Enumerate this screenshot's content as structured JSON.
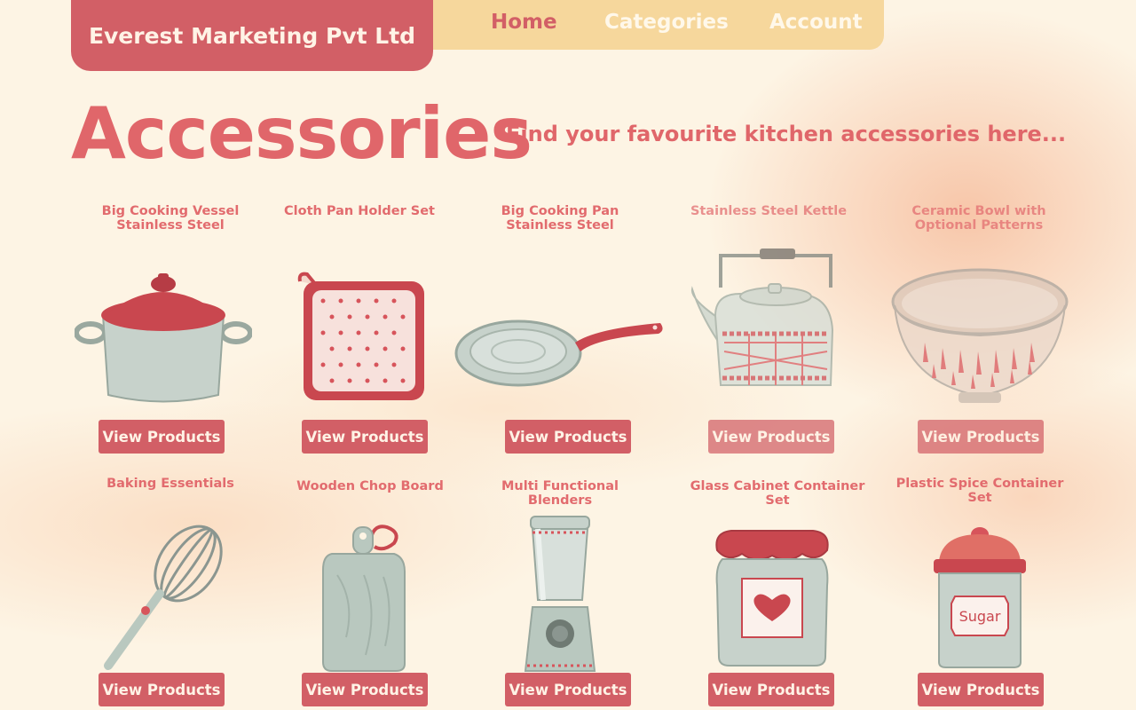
{
  "brand": "Everest Marketing Pvt Ltd",
  "nav": {
    "items": [
      {
        "label": "Home",
        "active": true
      },
      {
        "label": "Categories",
        "active": false
      },
      {
        "label": "Account",
        "active": false
      }
    ]
  },
  "page": {
    "title": "Accessories",
    "subtitle": "Find your favourite kitchen accessories here..."
  },
  "colors": {
    "accent": "#d25f66",
    "nav_bg": "#f6d79c",
    "page_bg": "#fdf4e4",
    "title": "#e0666a"
  },
  "products": [
    {
      "title": "Big Cooking Vessel Stainless Steel",
      "button": "View Products",
      "icon": "cooking-pot-icon"
    },
    {
      "title": "Cloth Pan Holder Set",
      "button": "View Products",
      "icon": "pan-holder-icon"
    },
    {
      "title": "Big Cooking Pan Stainless Steel",
      "button": "View Products",
      "icon": "frying-pan-icon"
    },
    {
      "title": "Stainless Steel Kettle",
      "button": "View Products",
      "icon": "kettle-icon"
    },
    {
      "title": "Ceramic Bowl with Optional Patterns",
      "button": "View Products",
      "icon": "ceramic-bowl-icon"
    },
    {
      "title": "Baking Essentials",
      "button": "View Products",
      "icon": "whisk-icon"
    },
    {
      "title": "Wooden Chop Board",
      "button": "View Products",
      "icon": "chopping-board-icon"
    },
    {
      "title": "Multi Functional Blenders",
      "button": "View Products",
      "icon": "blender-icon"
    },
    {
      "title": "Glass Cabinet Container Set",
      "button": "View Products",
      "icon": "jar-container-icon"
    },
    {
      "title": "Plastic Spice Container Set",
      "button": "View Products",
      "icon": "spice-container-icon"
    }
  ],
  "spice_label": "Sugar"
}
